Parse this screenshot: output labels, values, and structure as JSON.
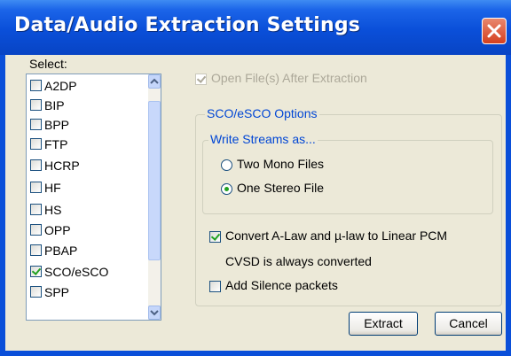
{
  "window": {
    "title": "Data/Audio Extraction Settings"
  },
  "select_label": "Select:",
  "profiles": [
    {
      "label": "A2DP",
      "checked": false
    },
    {
      "label": "BIP",
      "checked": false
    },
    {
      "label": "BPP",
      "checked": false
    },
    {
      "label": "FTP",
      "checked": false
    },
    {
      "label": "HCRP",
      "checked": false
    },
    {
      "label": "HF",
      "checked": false
    },
    {
      "label": "HS",
      "checked": false
    },
    {
      "label": "OPP",
      "checked": false
    },
    {
      "label": "PBAP",
      "checked": false
    },
    {
      "label": "SCO/eSCO",
      "checked": true
    },
    {
      "label": "SPP",
      "checked": false
    }
  ],
  "open_files": {
    "label": "Open File(s) After Extraction",
    "checked": true,
    "enabled": false
  },
  "sco_group": {
    "legend": "SCO/eSCO Options",
    "write_group": {
      "legend": "Write Streams as...",
      "options": [
        {
          "label": "Two Mono Files",
          "selected": false
        },
        {
          "label": "One Stereo File",
          "selected": true
        }
      ]
    },
    "convert": {
      "label": "Convert A-Law and µ-law to Linear PCM",
      "checked": true
    },
    "cvsd_note": "CVSD is always converted",
    "silence": {
      "label": "Add Silence packets",
      "checked": false
    }
  },
  "buttons": {
    "extract": "Extract",
    "cancel": "Cancel"
  },
  "icons": {
    "close": "close-icon",
    "scroll_up": "scroll-up-arrow-icon",
    "scroll_down": "scroll-down-arrow-icon"
  },
  "colors": {
    "titlebar": "#0a4fd9",
    "close_button": "#d5401f",
    "check_green": "#21a121",
    "legend_blue": "#0046d5"
  }
}
